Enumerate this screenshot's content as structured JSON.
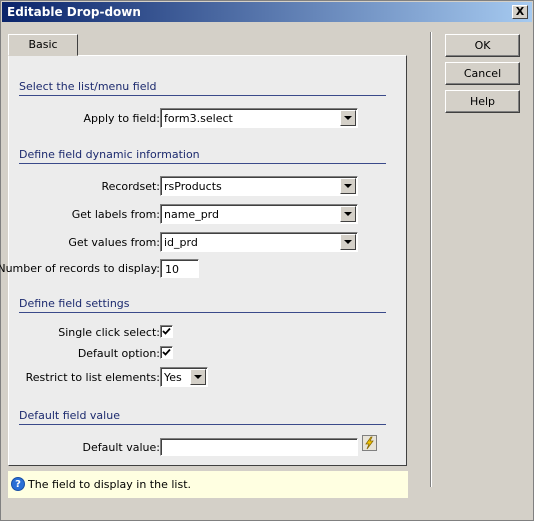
{
  "window": {
    "title": "Editable Drop-down",
    "close_label": "X"
  },
  "tabs": [
    {
      "label": "Basic"
    }
  ],
  "sections": {
    "select_list": "Select the list/menu field",
    "dynamic_info": "Define field dynamic information",
    "field_settings": "Define field settings",
    "default_value": "Default field value"
  },
  "fields": {
    "apply_to": {
      "label": "Apply to field:",
      "value": "form3.select"
    },
    "recordset": {
      "label": "Recordset:",
      "value": "rsProducts"
    },
    "labels_from": {
      "label": "Get labels from:",
      "value": "name_prd"
    },
    "values_from": {
      "label": "Get values from:",
      "value": "id_prd"
    },
    "num_records": {
      "label": "Number of records to display:",
      "value": "10"
    },
    "single_click": {
      "label": "Single click select:",
      "checked": true
    },
    "default_option": {
      "label": "Default option:",
      "checked": true
    },
    "restrict": {
      "label": "Restrict to list elements:",
      "value": "Yes"
    },
    "default_val": {
      "label": "Default value:",
      "value": ""
    }
  },
  "buttons": {
    "ok": "OK",
    "cancel": "Cancel",
    "help": "Help"
  },
  "help": {
    "icon": "help-icon",
    "text": "The field to display in the list."
  },
  "icons": {
    "dynamic": "lightning-bolt-icon",
    "check": "check-icon",
    "dropdown": "dropdown-arrow-icon"
  },
  "colors": {
    "titlebar": "#0a246a",
    "section_text": "#1c2a6e",
    "help_bg": "#ffffe1"
  }
}
